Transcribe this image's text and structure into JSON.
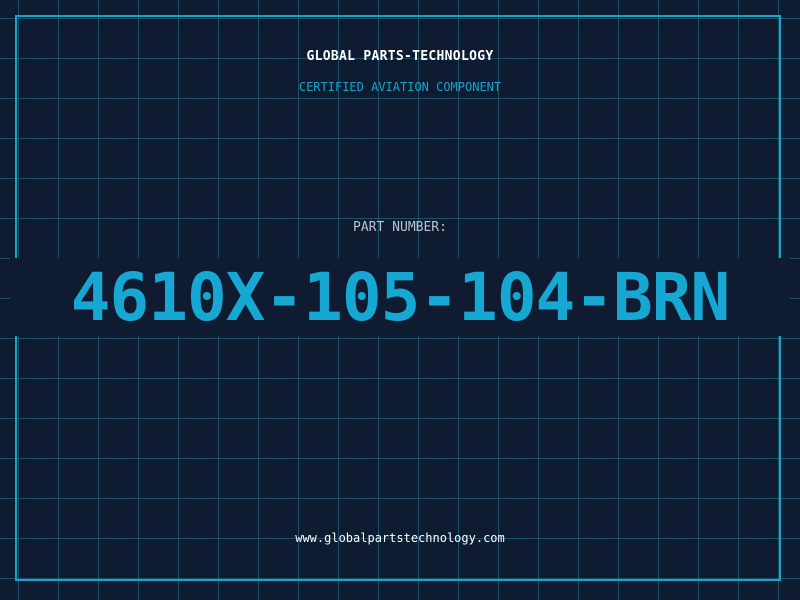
{
  "header": {
    "company": "GLOBAL PARTS-TECHNOLOGY",
    "certification": "CERTIFIED AVIATION COMPONENT"
  },
  "part": {
    "label": "PART NUMBER:",
    "number": "4610X-105-104-BRN"
  },
  "footer": {
    "website": "www.globalpartstechnology.com"
  },
  "colors": {
    "background": "#0f1b30",
    "grid": "#26789a",
    "accent": "#1aa3c9",
    "text": "#ffffff",
    "label": "#b8c3cf"
  }
}
